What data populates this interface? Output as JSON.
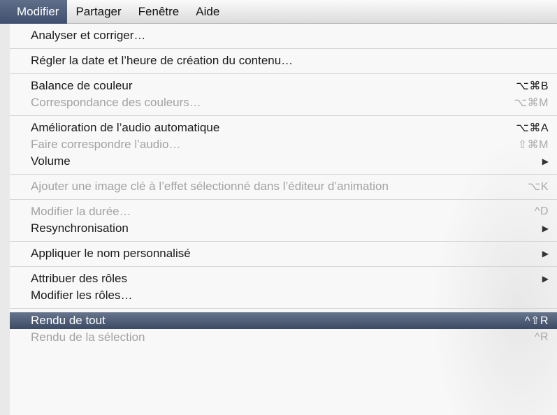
{
  "menubar": {
    "items": [
      {
        "label": "Modifier",
        "active": true
      },
      {
        "label": "Partager",
        "active": false
      },
      {
        "label": "Fenêtre",
        "active": false
      },
      {
        "label": "Aide",
        "active": false
      }
    ]
  },
  "menu": {
    "items": [
      {
        "label": "Analyser et corriger…",
        "shortcut": "",
        "enabled": true
      },
      {
        "label": "Régler la date et l’heure de création du contenu…",
        "shortcut": "",
        "enabled": true
      },
      {
        "label": "Balance de couleur",
        "shortcut": "⌥⌘B",
        "enabled": true
      },
      {
        "label": "Correspondance des couleurs…",
        "shortcut": "⌥⌘M",
        "enabled": false
      },
      {
        "label": "Amélioration de l’audio automatique",
        "shortcut": "⌥⌘A",
        "enabled": true
      },
      {
        "label": "Faire correspondre l’audio…",
        "shortcut": "⇧⌘M",
        "enabled": false
      },
      {
        "label": "Volume",
        "shortcut": "",
        "enabled": true,
        "submenu_arrow": "▶"
      },
      {
        "label": "Ajouter une image clé à l’effet sélectionné dans l’éditeur d’animation",
        "shortcut": "⌥K",
        "enabled": false
      },
      {
        "label": "Modifier la durée…",
        "shortcut": "^D",
        "enabled": false
      },
      {
        "label": "Resynchronisation",
        "shortcut": "",
        "enabled": true,
        "submenu_arrow": "▶"
      },
      {
        "label": "Appliquer le nom personnalisé",
        "shortcut": "",
        "enabled": true,
        "submenu_arrow": "▶"
      },
      {
        "label": "Attribuer des rôles",
        "shortcut": "",
        "enabled": true,
        "submenu_arrow": "▶"
      },
      {
        "label": "Modifier les rôles…",
        "shortcut": "",
        "enabled": true
      },
      {
        "label": "Rendu de tout",
        "shortcut": "^⇧R",
        "enabled": true,
        "highlighted": true
      },
      {
        "label": "Rendu de la sélection",
        "shortcut": "^R",
        "enabled": false
      }
    ]
  },
  "colors": {
    "highlight": "#4a5874",
    "disabled_text": "#a2a2a2",
    "menu_bg": "#f8f8f8"
  }
}
